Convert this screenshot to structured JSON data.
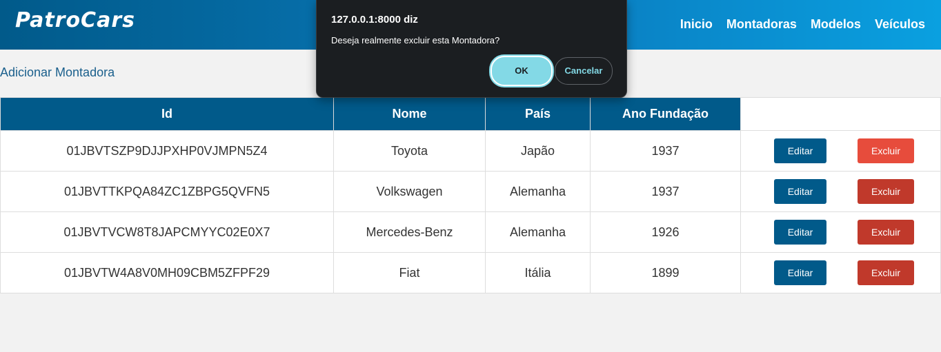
{
  "header": {
    "logo": "PatroCars",
    "nav": [
      "Inicio",
      "Montadoras",
      "Modelos",
      "Veículos"
    ]
  },
  "add_link": "Adicionar Montadora",
  "table": {
    "headers": [
      "Id",
      "Nome",
      "País",
      "Ano Fundação"
    ],
    "rows": [
      {
        "id": "01JBVTSZP9DJJPXHP0VJMPN5Z4",
        "nome": "Toyota",
        "pais": "Japão",
        "ano": "1937"
      },
      {
        "id": "01JBVTTKPQA84ZC1ZBPG5QVFN5",
        "nome": "Volkswagen",
        "pais": "Alemanha",
        "ano": "1937"
      },
      {
        "id": "01JBVTVCW8T8JAPCMYYC02E0X7",
        "nome": "Mercedes-Benz",
        "pais": "Alemanha",
        "ano": "1926"
      },
      {
        "id": "01JBVTW4A8V0MH09CBM5ZFPF29",
        "nome": "Fiat",
        "pais": "Itália",
        "ano": "1899"
      }
    ],
    "edit_label": "Editar",
    "delete_label": "Excluir"
  },
  "dialog": {
    "title": "127.0.0.1:8000 diz",
    "message": "Deseja realmente excluir esta Montadora?",
    "ok_label": "OK",
    "cancel_label": "Cancelar"
  },
  "colors": {
    "brand": "#015a8a",
    "delete": "#c0392b",
    "dialog_accent": "#83d9e6"
  }
}
